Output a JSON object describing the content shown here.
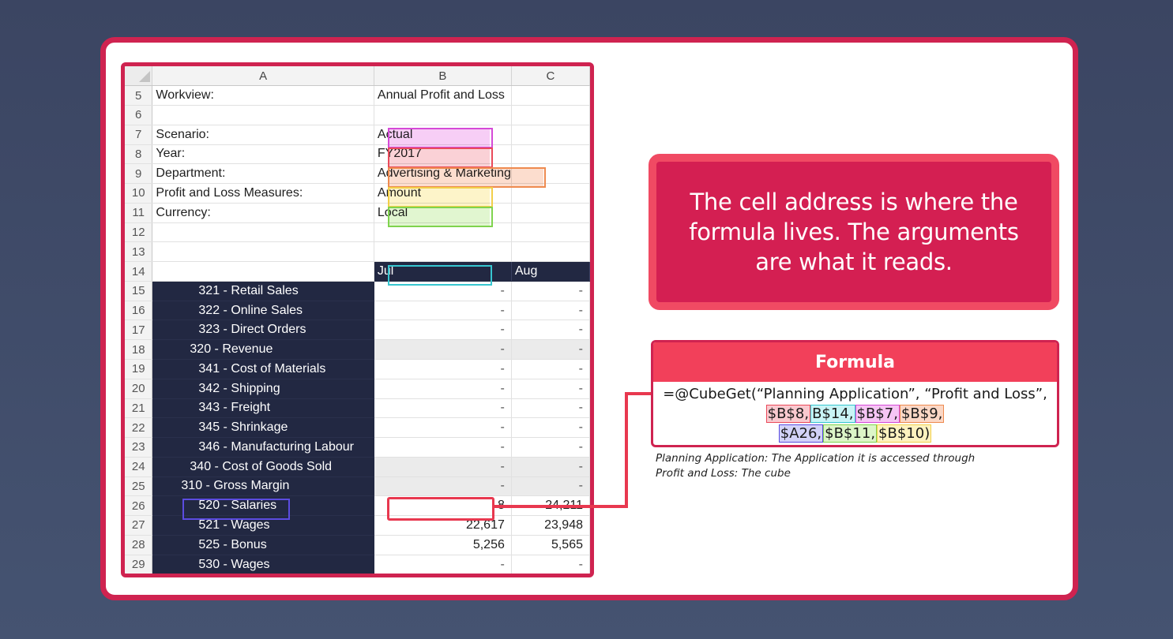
{
  "sheet": {
    "columns": [
      "A",
      "B",
      "C"
    ],
    "rows": [
      {
        "n": "5",
        "a": "Workview:",
        "b": "Annual Profit and Loss",
        "c": ""
      },
      {
        "n": "6",
        "a": "",
        "b": "",
        "c": ""
      },
      {
        "n": "7",
        "a": "Scenario:",
        "b": "Actual",
        "c": ""
      },
      {
        "n": "8",
        "a": "Year:",
        "b": "FY2017",
        "c": ""
      },
      {
        "n": "9",
        "a": "Department:",
        "b": "Advertising & Marketing",
        "c": ""
      },
      {
        "n": "10",
        "a": "Profit and Loss Measures:",
        "b": "Amount",
        "c": ""
      },
      {
        "n": "11",
        "a": "Currency:",
        "b": "Local",
        "c": ""
      },
      {
        "n": "12",
        "a": "",
        "b": "",
        "c": ""
      },
      {
        "n": "13",
        "a": "",
        "b": "",
        "c": ""
      },
      {
        "n": "14",
        "a": "",
        "b": "Jul",
        "c": "Aug"
      },
      {
        "n": "15",
        "a": "321 - Retail Sales",
        "b": "-",
        "c": "-"
      },
      {
        "n": "16",
        "a": "322 - Online Sales",
        "b": "-",
        "c": "-"
      },
      {
        "n": "17",
        "a": "323 - Direct Orders",
        "b": "-",
        "c": "-"
      },
      {
        "n": "18",
        "a": "320 - Revenue",
        "b": "-",
        "c": "-"
      },
      {
        "n": "19",
        "a": "341 - Cost of Materials",
        "b": "-",
        "c": "-"
      },
      {
        "n": "20",
        "a": "342 - Shipping",
        "b": "-",
        "c": "-"
      },
      {
        "n": "21",
        "a": "343 - Freight",
        "b": "-",
        "c": "-"
      },
      {
        "n": "22",
        "a": "345 - Shrinkage",
        "b": "-",
        "c": "-"
      },
      {
        "n": "23",
        "a": "346 - Manufacturing Labour",
        "b": "-",
        "c": "-"
      },
      {
        "n": "24",
        "a": "340 - Cost of Goods Sold",
        "b": "-",
        "c": "-"
      },
      {
        "n": "25",
        "a": "310 - Gross Margin",
        "b": "-",
        "c": "-"
      },
      {
        "n": "26",
        "a": "520 - Salaries",
        "b": "8",
        "c": "24,211"
      },
      {
        "n": "27",
        "a": "521 - Wages",
        "b": "22,617",
        "c": "23,948"
      },
      {
        "n": "28",
        "a": "525 - Bonus",
        "b": "5,256",
        "c": "5,565"
      },
      {
        "n": "29",
        "a": "530 - Wages",
        "b": "-",
        "c": "-"
      }
    ]
  },
  "callout": {
    "text": "The cell address is where the formula lives. The arguments are what it reads."
  },
  "formula": {
    "title": "Formula",
    "prefix": "=@CubeGet(“Planning Application”, “Profit and Loss”,",
    "tokens_line1": [
      "$B$8,",
      "B$14,",
      "$B$7,",
      "$B$9,"
    ],
    "tokens_line2": [
      "$A26,",
      "$B$11,",
      "$B$10)"
    ]
  },
  "notes": {
    "line1": "Planning Application:  The Application it is accessed through",
    "line2": "Profit and Loss: The cube"
  },
  "colors": {
    "frame": "#cf2350",
    "callout_bg": "#d41f52",
    "navy": "#222842",
    "scenario": "#d54ad7",
    "year": "#ea4a5a",
    "department": "#ee8a4f",
    "measure": "#f2cf4a",
    "currency": "#7fd34e",
    "period": "#37c6d0",
    "account": "#5b4ce0"
  }
}
